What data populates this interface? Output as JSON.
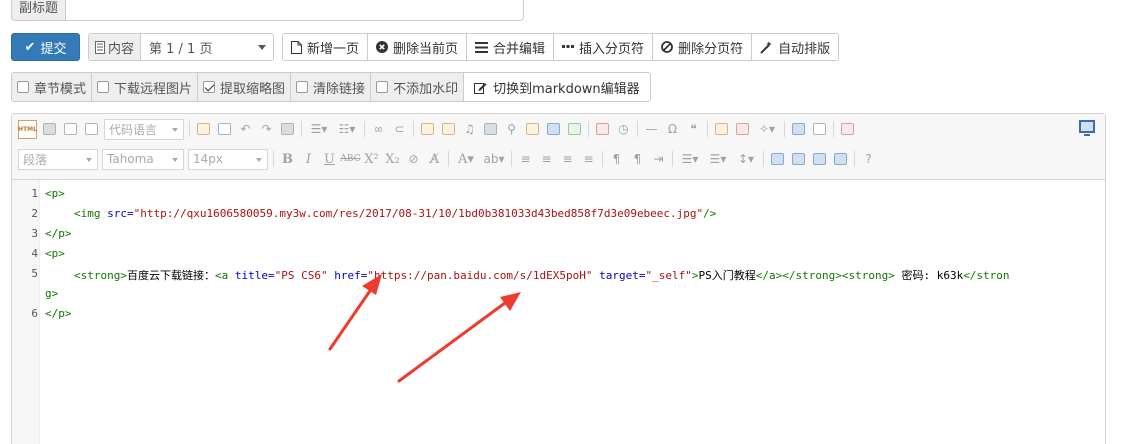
{
  "subtitle": {
    "label": "副标题",
    "value": ""
  },
  "actions": {
    "submit_label": "提交",
    "page_addon": "内容",
    "page_select": "第 1 / 1 页",
    "buttons": [
      {
        "label": "新增一页",
        "icon": "file-icon"
      },
      {
        "label": "删除当前页",
        "icon": "times-circle-icon"
      },
      {
        "label": "合并编辑",
        "icon": "list-icon"
      },
      {
        "label": "插入分页符",
        "icon": "ellipsis-icon"
      },
      {
        "label": "删除分页符",
        "icon": "ban-icon"
      },
      {
        "label": "自动排版",
        "icon": "magic-icon"
      }
    ]
  },
  "options": {
    "items": [
      {
        "label": "章节模式",
        "checked": false
      },
      {
        "label": "下载远程图片",
        "checked": false
      },
      {
        "label": "提取缩略图",
        "checked": true
      },
      {
        "label": "清除链接",
        "checked": false
      },
      {
        "label": "不添加水印",
        "checked": false
      }
    ],
    "switch_label": "切换到markdown编辑器"
  },
  "toolbar": {
    "html_icon": "HTML",
    "code_lang": "代码语言",
    "paragraph": "段落",
    "font_family": "Tahoma",
    "font_size": "14px"
  },
  "code": {
    "line_numbers": [
      "1",
      "2",
      "3",
      "4",
      "5",
      "",
      "6"
    ],
    "l1_open": "<p>",
    "l2_open": "<img ",
    "l2_attr": "src=",
    "l2_val": "\"http://qxu1606580059.my3w.com/res/2017/08-31/10/1bd0b381033d43bed858f7d3e09ebeec.jpg\"",
    "l2_close": "/>",
    "l3": "</p>",
    "l4": "<p>",
    "l5_strong_open": "<strong>",
    "l5_text": "百度云下载链接：",
    "l5_a_open": "<a ",
    "l5_title_attr": "title=",
    "l5_title_val": "\"PS CS6\"",
    "l5_href_attr": "href=",
    "l5_href_val": "\"https://pan.baidu.com/s/1dEX5poH\"",
    "l5_target_attr": "target=",
    "l5_target_val": "\"_self\"",
    "l5_a_gt": ">",
    "l5_link_text": "PS入门教程",
    "l5_a_close": "</a>",
    "l5_strong_close": "</strong>",
    "l5_strong_open2": "<strong>",
    "l5_pw": " 密码: k63k",
    "l5_end": "</stron",
    "l5b_end": "g>",
    "l6": "</p>"
  },
  "colors": {
    "primary": "#337ab7",
    "arrow": "#ee3b2f",
    "tag": "#117700",
    "attr": "#0000cc",
    "string": "#aa1111"
  }
}
